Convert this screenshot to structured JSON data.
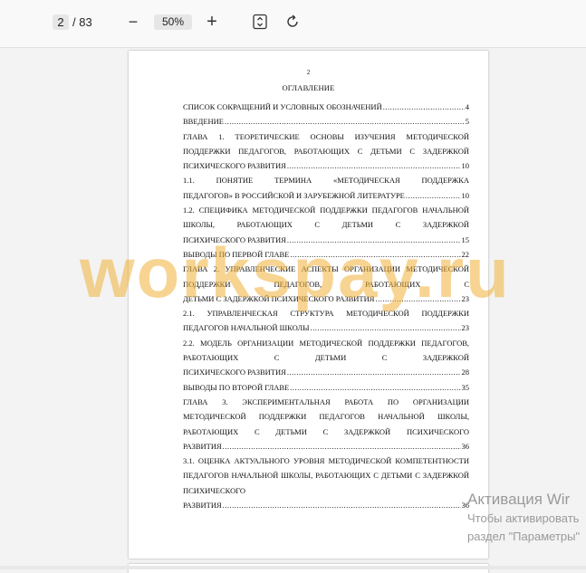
{
  "toolbar": {
    "page_current": "2",
    "page_total": "/ 83",
    "zoom_out": "−",
    "zoom_level": "50%",
    "zoom_in": "+",
    "fit_icon": "fit-page-icon",
    "rotate_icon": "rotate-icon"
  },
  "document": {
    "page_number": "2",
    "toc_title": "ОГЛАВЛЕНИЕ",
    "entries": [
      {
        "lines": [],
        "last": "СПИСОК СОКРАЩЕНИЙ И УСЛОВНЫХ ОБОЗНАЧЕНИЙ",
        "page": "4"
      },
      {
        "lines": [],
        "last": "ВВЕДЕНИЕ",
        "page": "5"
      },
      {
        "lines": [
          "ГЛАВА 1. ТЕОРЕТИЧЕСКИЕ ОСНОВЫ ИЗУЧЕНИЯ МЕТОДИЧЕСКОЙ ПОДДЕРЖКИ ПЕДАГОГОВ, РАБОТАЮЩИХ С ДЕТЬМИ С ЗАДЕРЖКОЙ"
        ],
        "last": "ПСИХИЧЕСКОГО РАЗВИТИЯ",
        "page": "10"
      },
      {
        "lines": [
          "1.1. ПОНЯТИЕ ТЕРМИНА «МЕТОДИЧЕСКАЯ ПОДДЕРЖКА"
        ],
        "last": "ПЕДАГОГОВ» В РОССИЙСКОЙ И ЗАРУБЕЖНОЙ ЛИТЕРАТУРЕ",
        "page": "10"
      },
      {
        "lines": [
          "1.2. СПЕЦИФИКА МЕТОДИЧЕСКОЙ ПОДДЕРЖКИ ПЕДАГОГОВ НАЧАЛЬНОЙ ШКОЛЫ, РАБОТАЮЩИХ С ДЕТЬМИ С ЗАДЕРЖКОЙ"
        ],
        "last": "ПСИХИЧЕСКОГО РАЗВИТИЯ",
        "page": "15"
      },
      {
        "lines": [],
        "last": "ВЫВОДЫ ПО ПЕРВОЙ ГЛАВЕ",
        "page": "22"
      },
      {
        "lines": [
          "ГЛАВА 2. УПРАВЛЕНЧЕСКИЕ АСПЕКТЫ ОРГАНИЗАЦИИ МЕТОДИЧЕСКОЙ ПОДДЕРЖКИ ПЕДАГОГОВ, РАБОТАЮЩИХ С"
        ],
        "last": "ДЕТЬМИ С ЗАДЕРЖКОЙ ПСИХИЧЕСКОГО РАЗВИТИЯ",
        "page": "23"
      },
      {
        "lines": [
          "2.1. УПРАВЛЕНЧЕСКАЯ СТРУКТУРА МЕТОДИЧЕСКОЙ ПОДДЕРЖКИ"
        ],
        "last": "ПЕДАГОГОВ НАЧАЛЬНОЙ ШКОЛЫ",
        "page": "23"
      },
      {
        "lines": [
          "2.2. МОДЕЛЬ ОРГАНИЗАЦИИ МЕТОДИЧЕСКОЙ ПОДДЕРЖКИ ПЕДАГОГОВ, РАБОТАЮЩИХ С ДЕТЬМИ С ЗАДЕРЖКОЙ"
        ],
        "last": "ПСИХИЧЕСКОГО РАЗВИТИЯ",
        "page": "28"
      },
      {
        "lines": [],
        "last": "ВЫВОДЫ ПО ВТОРОЙ ГЛАВЕ",
        "page": "35"
      },
      {
        "lines": [
          "ГЛАВА 3. ЭКСПЕРИМЕНТАЛЬНАЯ РАБОТА ПО ОРГАНИЗАЦИИ МЕТОДИЧЕСКОЙ ПОДДЕРЖКИ ПЕДАГОГОВ НАЧАЛЬНОЙ ШКОЛЫ, РАБОТАЮЩИХ С ДЕТЬМИ С ЗАДЕРЖКОЙ ПСИХИЧЕСКОГО"
        ],
        "last": "РАЗВИТИЯ",
        "page": "36"
      },
      {
        "lines": [
          "3.1. ОЦЕНКА АКТУАЛЬНОГО УРОВНЯ МЕТОДИЧЕСКОЙ КОМПЕТЕНТНОСТИ ПЕДАГОГОВ НАЧАЛЬНОЙ ШКОЛЫ, РАБОТАЮЩИХ С ДЕТЬМИ С ЗАДЕРЖКОЙ ПСИХИЧЕСКОГО"
        ],
        "last": "РАЗВИТИЯ",
        "page": "36"
      }
    ]
  },
  "watermark": "workspay.ru",
  "activation": {
    "title": "Активация Wir",
    "line1": "Чтобы активировать",
    "line2": "раздел \"Параметры\""
  }
}
